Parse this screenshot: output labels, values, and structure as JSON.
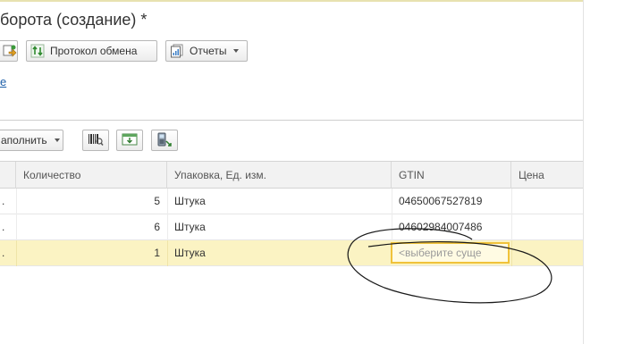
{
  "window": {
    "title": "борота (создание) *"
  },
  "toolbar": {
    "exchange_protocol_label": "Протокол обмена",
    "reports_label": "Отчеты"
  },
  "link_fragment": "е",
  "table_toolbar": {
    "fill_label": "аполнить"
  },
  "table": {
    "columns": [
      "Количество",
      "Упаковка, Ед. изм.",
      "GTIN",
      "Цена"
    ],
    "rows": [
      {
        "lead": ".",
        "quantity": "5",
        "unit": "Штука",
        "gtin": "04650067527819",
        "price": ""
      },
      {
        "lead": ".",
        "quantity": "6",
        "unit": "Штука",
        "gtin": "04602984007486",
        "price": ""
      },
      {
        "lead": ".",
        "quantity": "1",
        "unit": "Штука",
        "gtin_placeholder": "<выберите суще",
        "price": ""
      }
    ]
  },
  "colors": {
    "selected_row": "#fbf3c3",
    "edit_border": "#f0c23a",
    "link": "#1d5fa9"
  }
}
